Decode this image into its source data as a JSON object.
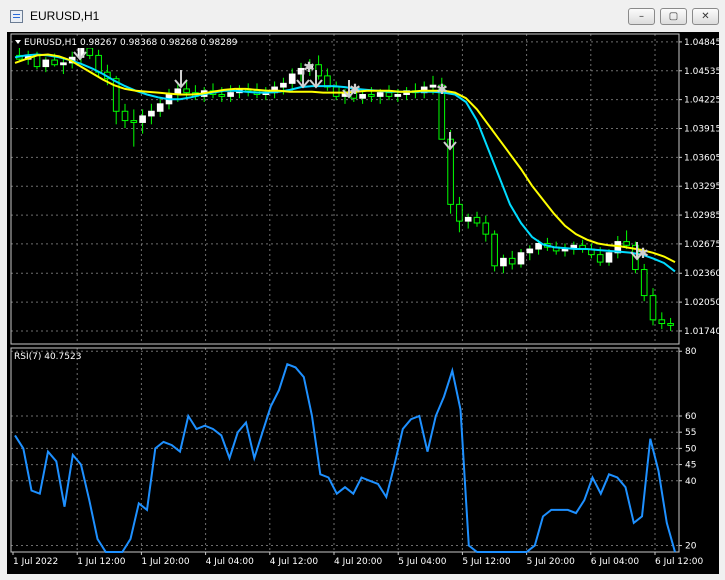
{
  "window": {
    "title": "EURUSD,H1"
  },
  "title_buttons": {
    "minimize": "–",
    "maximize": "▢",
    "close": "✕"
  },
  "colors": {
    "background": "#000000",
    "grid": "#c8c8c8",
    "bull_candle": "#ffffff",
    "bear_candle": "#000000",
    "candle_wick": "#00ff00",
    "ma_fast": "#00dcff",
    "ma_slow": "#ffff00",
    "rsi_line": "#1e90ff",
    "signal_arrow": "#d0d0d0",
    "text": "#ffffff"
  },
  "chart_data": [
    {
      "type": "candlestick",
      "header": "EURUSD,H1  0.98267 0.98368 0.98268 0.98289",
      "ylim": [
        1.016,
        1.0493
      ],
      "y_ticks": [
        "1.04845",
        "1.04535",
        "1.04225",
        "1.03915",
        "1.03605",
        "1.03295",
        "1.02985",
        "1.02675",
        "1.02360",
        "1.02050",
        "1.01740"
      ],
      "x_ticks": [
        "1 Jul 2022",
        "1 Jul 12:00",
        "1 Jul 20:00",
        "4 Jul 04:00",
        "4 Jul 12:00",
        "4 Jul 20:00",
        "5 Jul 04:00",
        "5 Jul 12:00",
        "5 Jul 20:00",
        "6 Jul 04:00",
        "6 Jul 12:00"
      ],
      "grid": true,
      "candles": [
        [
          1.047,
          1.0478,
          1.0463,
          1.0466
        ],
        [
          1.0466,
          1.0475,
          1.046,
          1.047
        ],
        [
          1.047,
          1.0474,
          1.0455,
          1.0458
        ],
        [
          1.0458,
          1.0468,
          1.0452,
          1.0465
        ],
        [
          1.0465,
          1.0472,
          1.0458,
          1.046
        ],
        [
          1.046,
          1.0466,
          1.045,
          1.0462
        ],
        [
          1.0462,
          1.0474,
          1.0456,
          1.0468
        ],
        [
          1.0468,
          1.0484,
          1.0462,
          1.0478
        ],
        [
          1.0478,
          1.0482,
          1.0466,
          1.047
        ],
        [
          1.047,
          1.0476,
          1.0446,
          1.0452
        ],
        [
          1.0452,
          1.046,
          1.0438,
          1.0445
        ],
        [
          1.0445,
          1.0448,
          1.0396,
          1.041
        ],
        [
          1.041,
          1.0418,
          1.0392,
          1.04
        ],
        [
          1.04,
          1.0412,
          1.0372,
          1.0398
        ],
        [
          1.0398,
          1.0412,
          1.0386,
          1.0405
        ],
        [
          1.0405,
          1.0418,
          1.0396,
          1.041
        ],
        [
          1.041,
          1.0424,
          1.0404,
          1.0418
        ],
        [
          1.0418,
          1.0434,
          1.0412,
          1.0428
        ],
        [
          1.0428,
          1.044,
          1.042,
          1.0434
        ],
        [
          1.0434,
          1.0444,
          1.0424,
          1.043
        ],
        [
          1.043,
          1.0438,
          1.0422,
          1.0426
        ],
        [
          1.0426,
          1.0436,
          1.042,
          1.0432
        ],
        [
          1.0432,
          1.044,
          1.0424,
          1.0428
        ],
        [
          1.0428,
          1.0436,
          1.042,
          1.0426
        ],
        [
          1.0426,
          1.0438,
          1.042,
          1.043
        ],
        [
          1.043,
          1.0438,
          1.0424,
          1.0434
        ],
        [
          1.0434,
          1.044,
          1.0426,
          1.0432
        ],
        [
          1.0432,
          1.044,
          1.0424,
          1.0428
        ],
        [
          1.0428,
          1.0436,
          1.0422,
          1.043
        ],
        [
          1.043,
          1.0442,
          1.0424,
          1.0436
        ],
        [
          1.0436,
          1.0446,
          1.0428,
          1.044
        ],
        [
          1.044,
          1.0456,
          1.0432,
          1.045
        ],
        [
          1.045,
          1.0462,
          1.0442,
          1.0456
        ],
        [
          1.0456,
          1.0466,
          1.0448,
          1.046
        ],
        [
          1.046,
          1.047,
          1.0444,
          1.0448
        ],
        [
          1.0448,
          1.0456,
          1.0432,
          1.0436
        ],
        [
          1.0436,
          1.0442,
          1.0422,
          1.0426
        ],
        [
          1.0426,
          1.0434,
          1.0418,
          1.043
        ],
        [
          1.043,
          1.0436,
          1.042,
          1.0424
        ],
        [
          1.0424,
          1.0432,
          1.0418,
          1.0428
        ],
        [
          1.0428,
          1.0436,
          1.042,
          1.0426
        ],
        [
          1.0426,
          1.0434,
          1.0418,
          1.043
        ],
        [
          1.043,
          1.0438,
          1.0422,
          1.0426
        ],
        [
          1.0426,
          1.0434,
          1.042,
          1.0428
        ],
        [
          1.0428,
          1.0436,
          1.0422,
          1.0432
        ],
        [
          1.0432,
          1.044,
          1.0424,
          1.043
        ],
        [
          1.043,
          1.0442,
          1.0424,
          1.0436
        ],
        [
          1.0436,
          1.0448,
          1.0428,
          1.0438
        ],
        [
          1.0438,
          1.0446,
          1.041,
          1.038
        ],
        [
          1.038,
          1.039,
          1.03,
          1.031
        ],
        [
          1.031,
          1.0318,
          1.028,
          1.0292
        ],
        [
          1.0292,
          1.03,
          1.0284,
          1.0296
        ],
        [
          1.0296,
          1.0302,
          1.0286,
          1.029
        ],
        [
          1.029,
          1.0298,
          1.027,
          1.0278
        ],
        [
          1.0278,
          1.0282,
          1.0238,
          1.0244
        ],
        [
          1.0244,
          1.0256,
          1.0236,
          1.0252
        ],
        [
          1.0252,
          1.026,
          1.024,
          1.0246
        ],
        [
          1.0246,
          1.0262,
          1.0242,
          1.0258
        ],
        [
          1.0258,
          1.0266,
          1.025,
          1.0262
        ],
        [
          1.0262,
          1.0272,
          1.0256,
          1.0268
        ],
        [
          1.0268,
          1.0274,
          1.026,
          1.0264
        ],
        [
          1.0264,
          1.027,
          1.0256,
          1.026
        ],
        [
          1.026,
          1.0268,
          1.0254,
          1.0262
        ],
        [
          1.0262,
          1.027,
          1.0256,
          1.0266
        ],
        [
          1.0266,
          1.0272,
          1.0258,
          1.0262
        ],
        [
          1.0262,
          1.0268,
          1.0252,
          1.0256
        ],
        [
          1.0256,
          1.0264,
          1.0244,
          1.0248
        ],
        [
          1.0248,
          1.0262,
          1.0244,
          1.0258
        ],
        [
          1.0258,
          1.0276,
          1.0252,
          1.027
        ],
        [
          1.027,
          1.0282,
          1.0262,
          1.0266
        ],
        [
          1.0266,
          1.027,
          1.0236,
          1.024
        ],
        [
          1.024,
          1.0246,
          1.0206,
          1.0212
        ],
        [
          1.0212,
          1.022,
          1.018,
          1.0186
        ],
        [
          1.0186,
          1.0194,
          1.0176,
          1.0182
        ],
        [
          1.0182,
          1.0188,
          1.0174,
          1.018
        ]
      ],
      "series": [
        {
          "values": [
            1.0468,
            1.047,
            1.0471,
            1.047,
            1.0468,
            1.0465,
            1.0461,
            1.0456,
            1.045,
            1.0443,
            1.0437,
            1.0432,
            1.0428,
            1.0425,
            1.0423,
            1.0423,
            1.0425,
            1.0428,
            1.043,
            1.0432,
            1.0432,
            1.0431,
            1.043,
            1.043,
            1.0431,
            1.0433,
            1.0436,
            1.0437,
            1.0437,
            1.0437,
            1.0436,
            1.0434,
            1.0433,
            1.0432,
            1.0431,
            1.0431,
            1.0431,
            1.0431,
            1.0431,
            1.043,
            1.0428,
            1.042,
            1.04,
            1.037,
            1.034,
            1.031,
            1.029,
            1.0275,
            1.0267,
            1.0264,
            1.0263,
            1.0262,
            1.0262,
            1.0261,
            1.026,
            1.0259,
            1.0258,
            1.0256,
            1.0252,
            1.0247,
            1.0238
          ]
        },
        {
          "values": [
            1.0462,
            1.0466,
            1.047,
            1.0471,
            1.0469,
            1.0465,
            1.0458,
            1.0451,
            1.0444,
            1.0438,
            1.0434,
            1.0432,
            1.0431,
            1.043,
            1.0429,
            1.0428,
            1.0428,
            1.0429,
            1.0431,
            1.0433,
            1.0434,
            1.0434,
            1.0433,
            1.0432,
            1.0432,
            1.0431,
            1.0431,
            1.0431,
            1.043,
            1.043,
            1.043,
            1.0431,
            1.0432,
            1.0432,
            1.0432,
            1.0431,
            1.0431,
            1.0432,
            1.0432,
            1.0432,
            1.043,
            1.0424,
            1.0412,
            1.0396,
            1.038,
            1.0364,
            1.0348,
            1.033,
            1.0315,
            1.03,
            1.0287,
            1.0278,
            1.0272,
            1.0268,
            1.0266,
            1.0265,
            1.0263,
            1.0261,
            1.0258,
            1.0254,
            1.0248
          ]
        }
      ],
      "markers": [
        "arrow",
        "star",
        "arrow",
        "arrow",
        "star",
        "arrow",
        "arrow",
        "star",
        "star",
        "arrow",
        "arrow",
        "star"
      ]
    },
    {
      "type": "line",
      "header": "RSI(7) 40.7523",
      "ylim": [
        18,
        81
      ],
      "y_ticks": [
        "80",
        "60",
        "55",
        "50",
        "45",
        "40",
        "20"
      ],
      "grid": true,
      "values": [
        54,
        50,
        37,
        36,
        49,
        46,
        32,
        48,
        45,
        34,
        22,
        18,
        18,
        18,
        22,
        33,
        31,
        50,
        52,
        51,
        49,
        60,
        56,
        57,
        56,
        54,
        47,
        55,
        58,
        47,
        55,
        63,
        68,
        76,
        75,
        72,
        60,
        42,
        41,
        36,
        38,
        36,
        41,
        40,
        39,
        35,
        45,
        56,
        59,
        60,
        49,
        60,
        66,
        74,
        62,
        20,
        18,
        18,
        18,
        18,
        18,
        18,
        18,
        20,
        29,
        31,
        31,
        31,
        30,
        34,
        41,
        36,
        42,
        41,
        38,
        27,
        29,
        53,
        43,
        27,
        18
      ]
    }
  ]
}
